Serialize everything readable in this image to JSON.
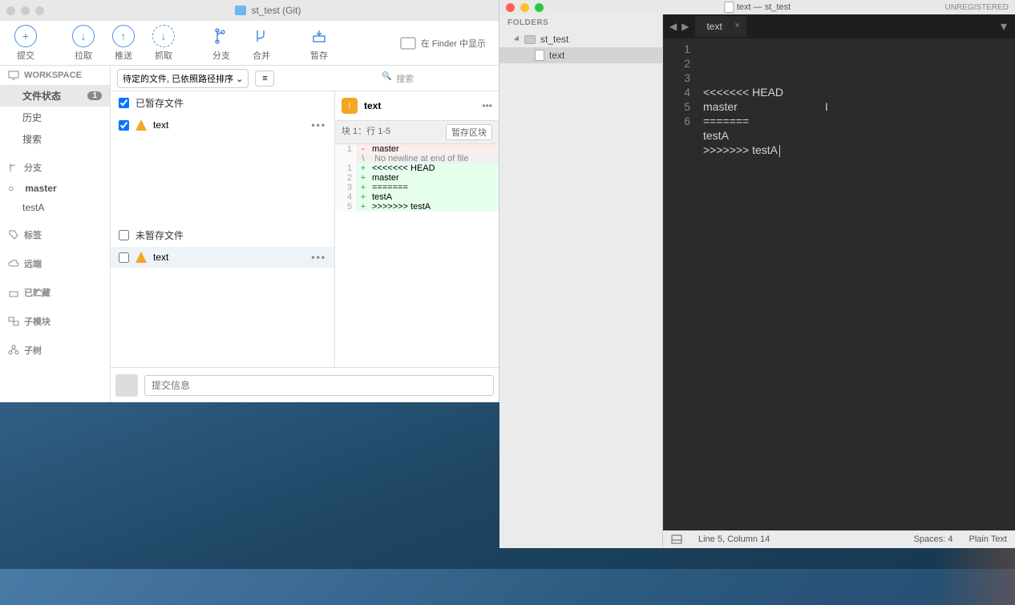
{
  "sourcetree": {
    "title": "st_test (Git)",
    "toolbar": {
      "commit": "提交",
      "pull": "拉取",
      "push": "推送",
      "fetch": "抓取",
      "branch": "分支",
      "merge": "合并",
      "stash": "暂存",
      "show_in_finder": "在 Finder 中显示"
    },
    "sidebar": {
      "workspace_header": "WORKSPACE",
      "file_status": "文件状态",
      "file_status_badge": "1",
      "history": "历史",
      "search": "搜索",
      "branch_header": "分支",
      "master": "master",
      "testA": "testA",
      "tags": "标签",
      "remote": "远端",
      "stashed": "已贮藏",
      "submodule": "子模块",
      "subtree": "子树"
    },
    "filter": {
      "dropdown": "待定的文件, 已依照路径排序",
      "list_icon": "≡",
      "search_placeholder": "搜索"
    },
    "staged": {
      "header": "已暂存文件",
      "files": [
        {
          "name": "text"
        }
      ]
    },
    "unstaged": {
      "header": "未暂存文件",
      "files": [
        {
          "name": "text"
        }
      ]
    },
    "diff": {
      "file": "text",
      "hunk_label": "块 1：行 1-5",
      "stage_hunk": "暂存区块",
      "lines": [
        {
          "n": "1",
          "mark": "-",
          "text": "master",
          "cls": "del"
        },
        {
          "n": "",
          "mark": "\\",
          "text": " No newline at end of file",
          "cls": "ctx"
        },
        {
          "n": "1",
          "mark": "+",
          "text": "<<<<<<< HEAD",
          "cls": "add"
        },
        {
          "n": "2",
          "mark": "+",
          "text": "master",
          "cls": "add"
        },
        {
          "n": "3",
          "mark": "+",
          "text": "=======",
          "cls": "add"
        },
        {
          "n": "4",
          "mark": "+",
          "text": "testA",
          "cls": "add"
        },
        {
          "n": "5",
          "mark": "+",
          "text": ">>>>>>> testA",
          "cls": "add"
        }
      ]
    },
    "commit_placeholder": "提交信息"
  },
  "sublime": {
    "title": "text — st_test",
    "unregistered": "UNREGISTERED",
    "folders_header": "FOLDERS",
    "folder": "st_test",
    "file": "text",
    "tab": "text",
    "code_lines": [
      "<<<<<<< HEAD",
      "master",
      "=======",
      "testA",
      ">>>>>>> testA",
      ""
    ],
    "gutter": [
      "1",
      "2",
      "3",
      "4",
      "5",
      "6"
    ],
    "status_pos": "Line 5, Column 14",
    "status_spaces": "Spaces: 4",
    "status_syntax": "Plain Text"
  }
}
